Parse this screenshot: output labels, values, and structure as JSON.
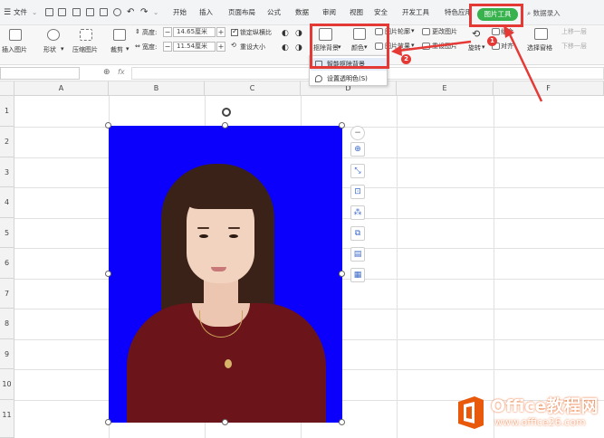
{
  "menubar": {
    "file_label": "文件",
    "tabs": [
      "开始",
      "插入",
      "页面布局",
      "公式",
      "数据",
      "审阅",
      "视图",
      "安全",
      "开发工具",
      "特色应用"
    ],
    "active_tab": "图片工具",
    "search_label": "数据录入"
  },
  "ribbon": {
    "insert_picture": "插入图片",
    "shape": "形状",
    "compress_picture": "压缩图片",
    "crop": "裁剪",
    "height_label": "高度:",
    "height_value": "14.65厘米",
    "width_label": "宽度:",
    "width_value": "11.54厘米",
    "lock_ratio": "锁定纵横比",
    "reset_size": "重设大小",
    "remove_bg": "抠除背景",
    "color": "颜色",
    "picture_outline": "图片轮廓",
    "change_picture": "更改图片",
    "picture_effect": "图片效果",
    "reset_picture": "重设图片",
    "rotate": "旋转",
    "combine": "组合",
    "align": "对齐",
    "selection_pane": "选择窗格",
    "bring_forward": "上移一层",
    "send_backward": "下移一层"
  },
  "formula_bar": {
    "fx": "fx"
  },
  "grid": {
    "columns": [
      "A",
      "B",
      "C",
      "D",
      "E",
      "F"
    ],
    "rows": [
      "1",
      "2",
      "3",
      "4",
      "5",
      "6",
      "7",
      "8",
      "9",
      "10",
      "11"
    ]
  },
  "dropdown": {
    "items": [
      "智能抠除背景",
      "设置透明色(S)"
    ]
  },
  "annotations": {
    "badge1": "1",
    "badge2": "2",
    "color": "#e53935"
  },
  "watermark": {
    "title": "Office教程网",
    "url": "www.office26.com"
  },
  "colors": {
    "photo_background": "#0b00fb",
    "active_tab": "#37b24d"
  }
}
